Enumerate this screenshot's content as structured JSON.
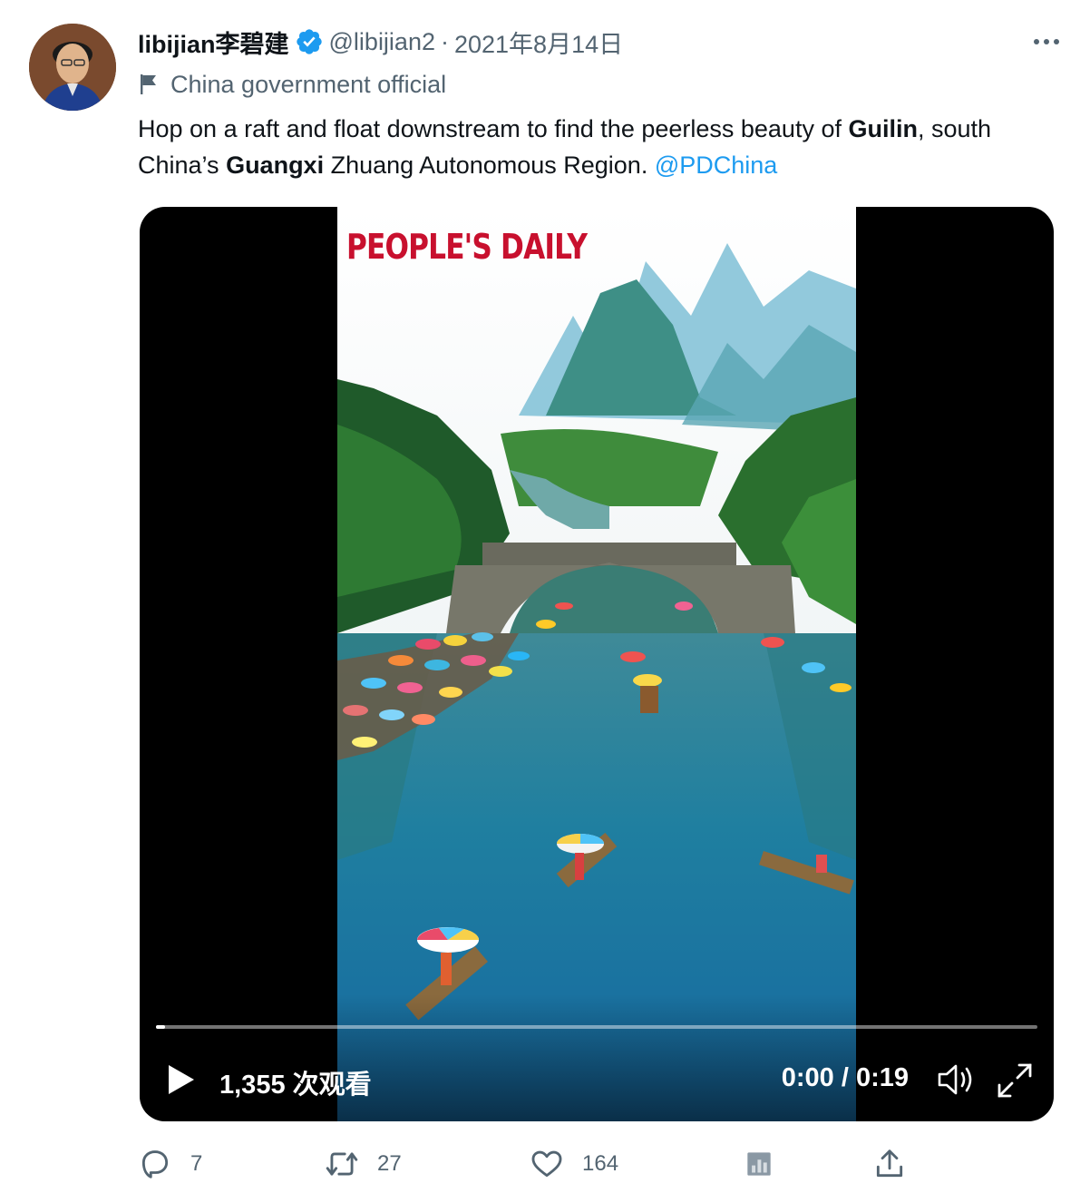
{
  "tweet": {
    "display_name": "libijian李碧建",
    "handle": "@libijian2",
    "separator": "·",
    "date": "2021年8月14日",
    "affiliation": "China government official",
    "text": {
      "part1": "Hop on a raft and float downstream to find the peerless beauty of ",
      "bold1": "Guilin",
      "part2": ", south China’s ",
      "bold2": "Guangxi",
      "part3": " Zhuang Autonomous Region. ",
      "mention": "@PDChina"
    }
  },
  "video": {
    "watermark": "PEOPLE'S DAILY",
    "views": "1,355 次观看",
    "time": "0:00 / 0:19",
    "progress": 0.01
  },
  "actions": {
    "reply_count": "7",
    "retweet_count": "27",
    "like_count": "164"
  },
  "icons": {
    "verified": "verified-badge-icon",
    "affiliation": "flag-icon",
    "more": "more-options-icon",
    "play": "play-icon",
    "volume": "volume-icon",
    "fullscreen": "fullscreen-icon",
    "reply": "reply-icon",
    "retweet": "retweet-icon",
    "like": "heart-icon",
    "analytics": "analytics-icon",
    "share": "share-icon"
  },
  "colors": {
    "accent": "#1d9bf0",
    "text": "#0f1419",
    "secondary": "#536471",
    "watermark": "#c8102e"
  }
}
